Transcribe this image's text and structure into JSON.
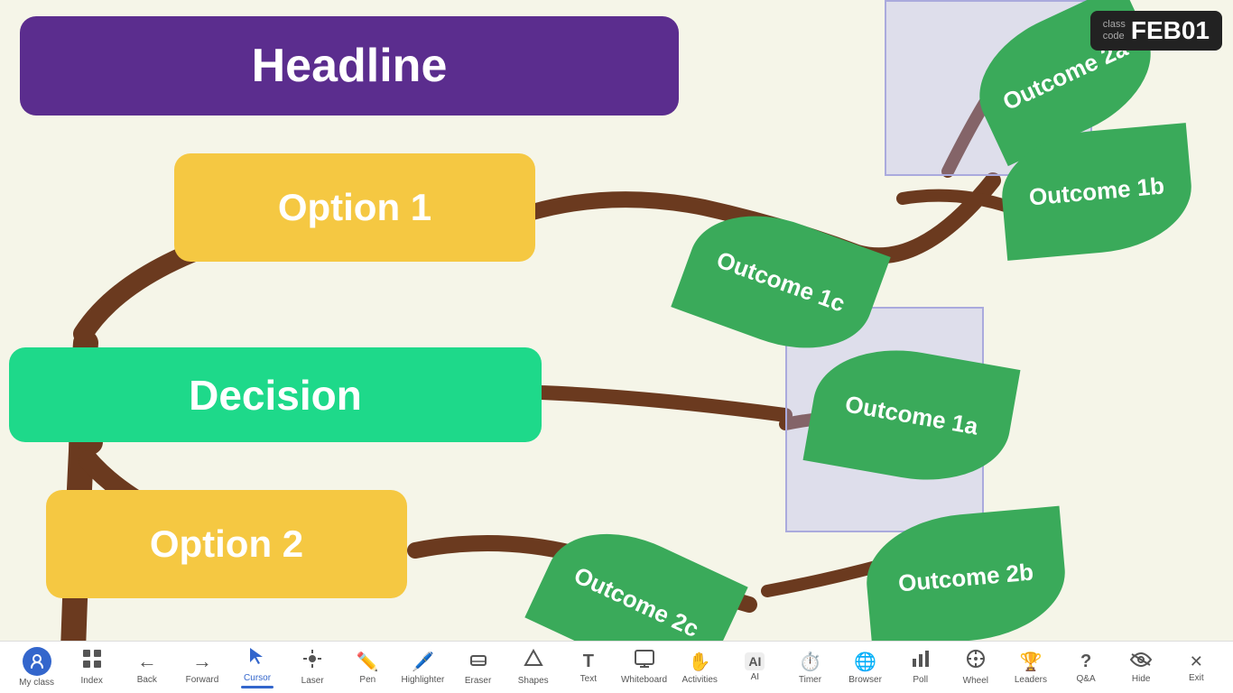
{
  "canvas": {
    "background": "#f5f5e8"
  },
  "class_code": {
    "label": "class\ncode",
    "code": "FEB01"
  },
  "headline": "Headline",
  "option1": "Option 1",
  "decision": "Decision",
  "option2": "Option 2",
  "outcomes": {
    "outcome2a": "Outcome 2a",
    "outcome1b": "Outcome 1b",
    "outcome1c": "Outcome 1c",
    "outcome1a": "Outcome 1a",
    "outcome2c": "Outcome 2c",
    "outcome2b": "Outcome 2b"
  },
  "toolbar": {
    "items": [
      {
        "id": "my-class",
        "label": "My class",
        "icon": "⟳"
      },
      {
        "id": "index",
        "label": "Index",
        "icon": "⊞"
      },
      {
        "id": "back",
        "label": "Back",
        "icon": "←"
      },
      {
        "id": "forward",
        "label": "Forward",
        "icon": "→"
      },
      {
        "id": "cursor",
        "label": "Cursor",
        "icon": "↖"
      },
      {
        "id": "laser",
        "label": "Laser",
        "icon": "✦"
      },
      {
        "id": "pen",
        "label": "Pen",
        "icon": "✏"
      },
      {
        "id": "highlighter",
        "label": "Highlighter",
        "icon": "⬛"
      },
      {
        "id": "eraser",
        "label": "Eraser",
        "icon": "◻"
      },
      {
        "id": "shapes",
        "label": "Shapes",
        "icon": "⬡"
      },
      {
        "id": "text",
        "label": "Text",
        "icon": "T"
      },
      {
        "id": "whiteboard",
        "label": "Whiteboard",
        "icon": "⬜"
      },
      {
        "id": "activities",
        "label": "Activities",
        "icon": "✋"
      },
      {
        "id": "ai",
        "label": "AI",
        "icon": "AI"
      },
      {
        "id": "timer",
        "label": "Timer",
        "icon": "⏱"
      },
      {
        "id": "browser",
        "label": "Browser",
        "icon": "🌐"
      },
      {
        "id": "poll",
        "label": "Poll",
        "icon": "📊"
      },
      {
        "id": "wheel",
        "label": "Wheel",
        "icon": "⭕"
      },
      {
        "id": "leaders",
        "label": "Leaders",
        "icon": "🏆"
      },
      {
        "id": "qna",
        "label": "Q&A",
        "icon": "?"
      },
      {
        "id": "hide",
        "label": "Hide",
        "icon": "👁"
      },
      {
        "id": "exit",
        "label": "Exit",
        "icon": "✕"
      }
    ]
  }
}
